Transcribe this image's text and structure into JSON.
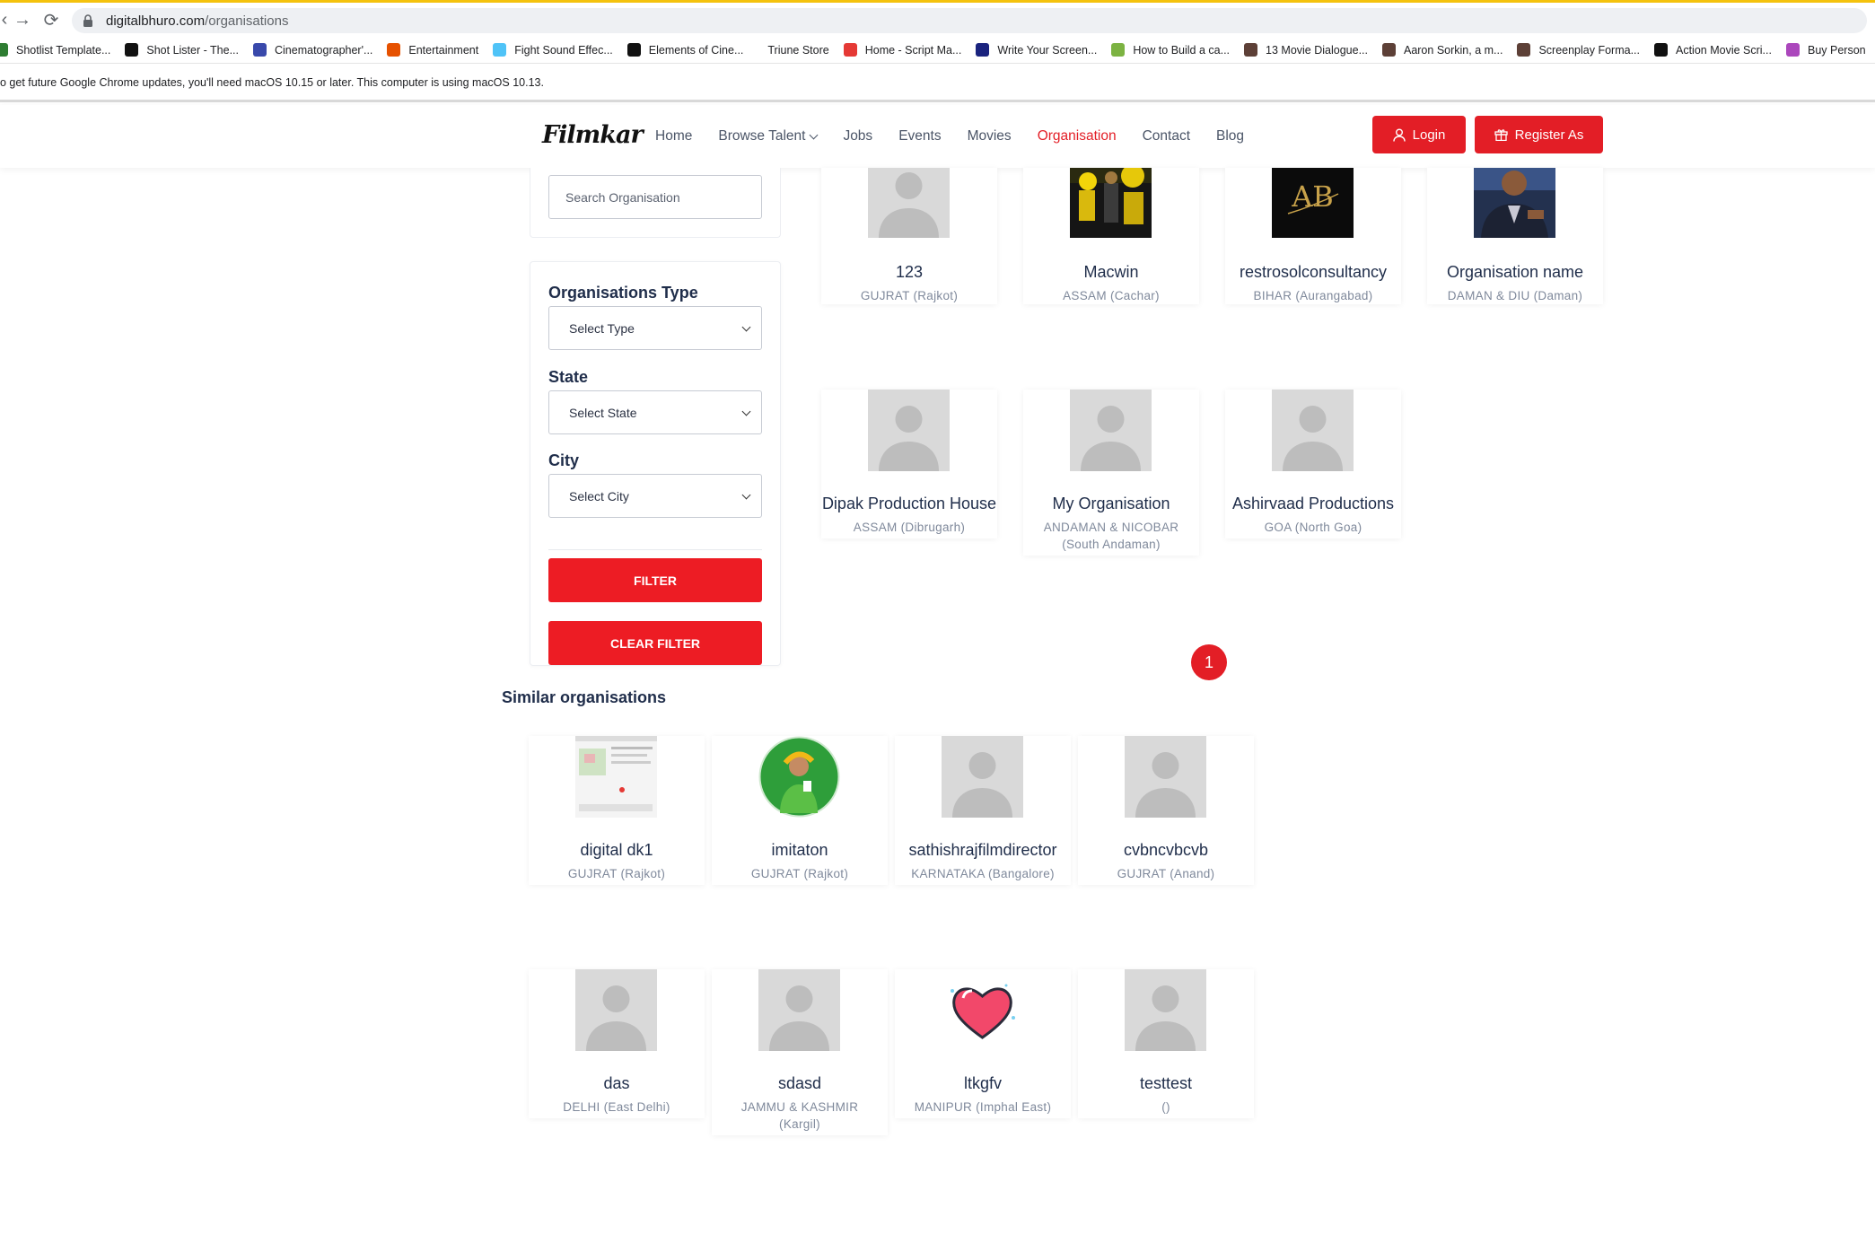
{
  "browser": {
    "url_host": "digitalbhuro.com",
    "url_path": "/organisations",
    "bookmarks": [
      {
        "label": "Shotlist Template...",
        "color": "#2e7d32"
      },
      {
        "label": "Shot Lister - The...",
        "color": "#111111"
      },
      {
        "label": "Cinematographer'...",
        "color": "#3949ab"
      },
      {
        "label": "Entertainment",
        "color": "#e65100"
      },
      {
        "label": "Fight Sound Effec...",
        "color": "#4fc3f7"
      },
      {
        "label": "Elements of Cine...",
        "color": "#111111"
      },
      {
        "label": "Triune Store",
        "color": "#ffffff"
      },
      {
        "label": "Home - Script Ma...",
        "color": "#e53935"
      },
      {
        "label": "Write Your Screen...",
        "color": "#1a237e"
      },
      {
        "label": "How to Build a ca...",
        "color": "#7cb342"
      },
      {
        "label": "13 Movie Dialogue...",
        "color": "#5d4037"
      },
      {
        "label": "Aaron Sorkin, a m...",
        "color": "#5d4037"
      },
      {
        "label": "Screenplay Forma...",
        "color": "#5d4037"
      },
      {
        "label": "Action Movie Scri...",
        "color": "#111111"
      },
      {
        "label": "Buy Person",
        "color": "#ab47bc"
      }
    ],
    "infobar_text": "o get future Google Chrome updates, you'll need macOS 10.15 or later. This computer is using macOS 10.13."
  },
  "header": {
    "logo": "Filmkar",
    "nav": [
      {
        "label": "Home",
        "active": false,
        "dropdown": false
      },
      {
        "label": "Browse Talent",
        "active": false,
        "dropdown": true
      },
      {
        "label": "Jobs",
        "active": false,
        "dropdown": false
      },
      {
        "label": "Events",
        "active": false,
        "dropdown": false
      },
      {
        "label": "Movies",
        "active": false,
        "dropdown": false
      },
      {
        "label": "Organisation",
        "active": true,
        "dropdown": false
      },
      {
        "label": "Contact",
        "active": false,
        "dropdown": false
      },
      {
        "label": "Blog",
        "active": false,
        "dropdown": false
      }
    ],
    "login_label": "Login",
    "register_label": "Register As",
    "accent_color": "#e31e26"
  },
  "sidebar": {
    "search_placeholder": "Search Organisation",
    "type_label": "Organisations Type",
    "type_value": "Select Type",
    "state_label": "State",
    "state_value": "Select State",
    "city_label": "City",
    "city_value": "Select City",
    "filter_label": "FILTER",
    "clear_label": "CLEAR FILTER"
  },
  "organisations": [
    {
      "name": "123",
      "location": "GUJRAT (Rajkot)",
      "image": "placeholder"
    },
    {
      "name": "Macwin",
      "location": "ASSAM (Cachar)",
      "image": "photo-yellow"
    },
    {
      "name": "restrosolconsultancy",
      "location": "BIHAR (Aurangabad)",
      "image": "logo-ab"
    },
    {
      "name": "Organisation name",
      "location": "DAMAN & DIU (Daman)",
      "image": "photo-man"
    },
    {
      "name": "Dipak Production House",
      "location": "ASSAM (Dibrugarh)",
      "image": "placeholder"
    },
    {
      "name": "My Organisation",
      "location": "ANDAMAN & NICOBAR (South Andaman)",
      "image": "placeholder"
    },
    {
      "name": "Ashirvaad Productions",
      "location": "GOA (North Goa)",
      "image": "placeholder"
    }
  ],
  "pagination": {
    "current_page": "1"
  },
  "similar": {
    "title": "Similar organisations",
    "items": [
      {
        "name": "digital dk1",
        "location": "GUJRAT (Rajkot)",
        "image": "screenshot"
      },
      {
        "name": "imitaton",
        "location": "GUJRAT (Rajkot)",
        "image": "photo-green"
      },
      {
        "name": "sathishrajfilmdirector",
        "location": "KARNATAKA (Bangalore)",
        "image": "placeholder"
      },
      {
        "name": "cvbncvbcvb",
        "location": "GUJRAT (Anand)",
        "image": "placeholder"
      },
      {
        "name": "das",
        "location": "DELHI (East Delhi)",
        "image": "placeholder"
      },
      {
        "name": "sdasd",
        "location": "JAMMU & KASHMIR (Kargil)",
        "image": "placeholder"
      },
      {
        "name": "ltkgfv",
        "location": "MANIPUR (Imphal East)",
        "image": "heart"
      },
      {
        "name": "testtest",
        "location": "()",
        "image": "placeholder"
      }
    ]
  }
}
